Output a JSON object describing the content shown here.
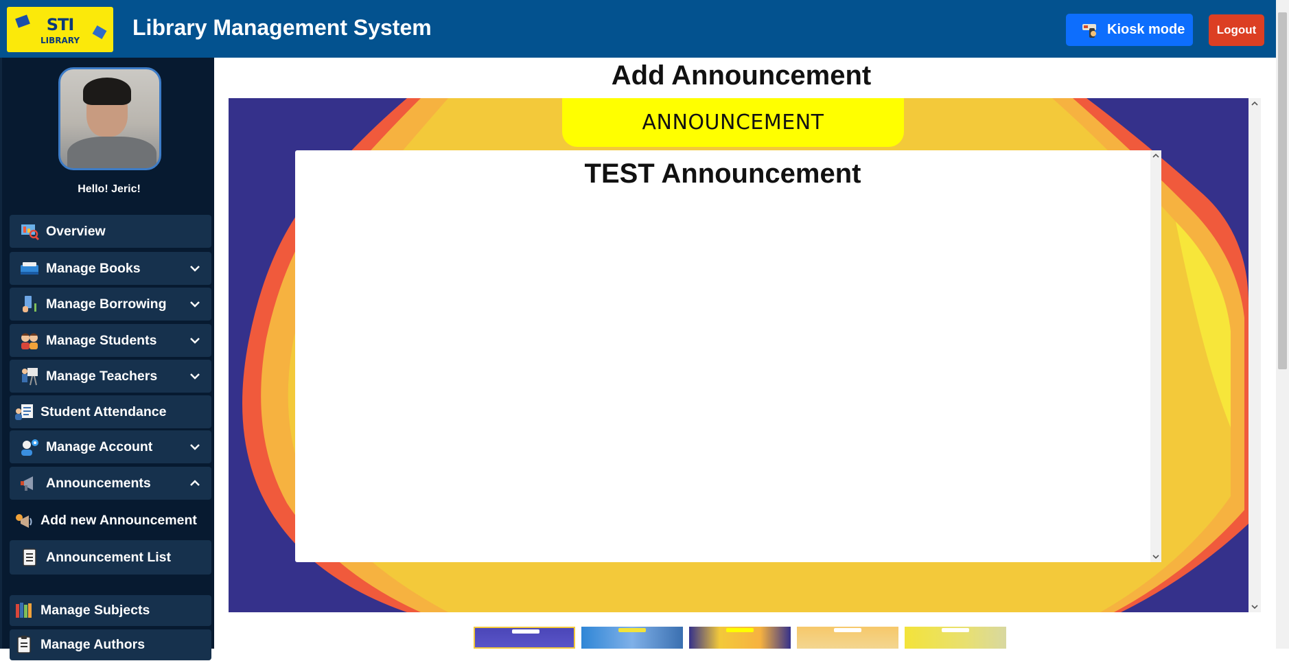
{
  "header": {
    "logo_line1": "STI",
    "logo_line2": "LIBRARY",
    "title": "Library Management System",
    "kiosk_label": "Kiosk mode",
    "logout_label": "Logout"
  },
  "sidebar": {
    "greeting": "Hello! Jeric!",
    "items": [
      {
        "label": "Overview",
        "icon": "overview-icon"
      },
      {
        "label": "Manage Books",
        "icon": "books-icon"
      },
      {
        "label": "Manage Borrowing",
        "icon": "borrowing-icon"
      },
      {
        "label": "Manage Students",
        "icon": "students-icon"
      },
      {
        "label": "Manage Teachers",
        "icon": "teachers-icon"
      },
      {
        "label": "Student Attendance",
        "icon": "attendance-icon"
      },
      {
        "label": "Manage Account",
        "icon": "account-icon"
      },
      {
        "label": "Announcements",
        "icon": "megaphone-icon"
      },
      {
        "label": "Add new Announcement",
        "icon": "add-announcement-icon"
      },
      {
        "label": "Announcement List",
        "icon": "list-icon"
      },
      {
        "label": "Manage Subjects",
        "icon": "subjects-icon"
      },
      {
        "label": "Manage Authors",
        "icon": "authors-icon"
      }
    ]
  },
  "main": {
    "title": "Add Announcement",
    "banner_label": "ANNOUNCEMENT",
    "announcement_title": "TEST Announcement"
  },
  "colors": {
    "header_bg": "#03528f",
    "sidebar_bg": "#071a30",
    "nav_item_bg": "#16314d",
    "kiosk_button": "#0d6efd",
    "logout_button": "#dc3f23",
    "banner_label_bg": "#ffff00"
  }
}
